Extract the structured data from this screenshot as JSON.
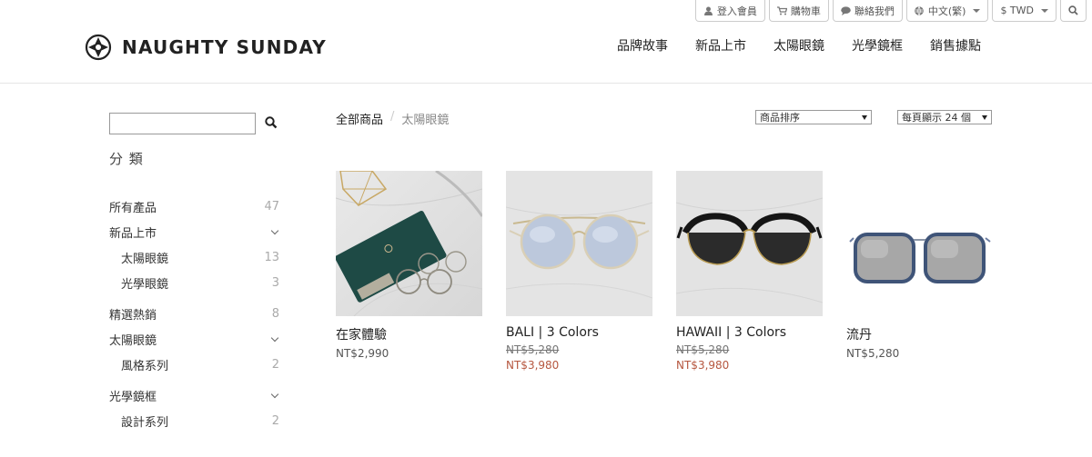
{
  "topbar": {
    "login": "登入會員",
    "cart": "購物車",
    "contact": "聯絡我們",
    "language": "中文(繁)",
    "currency": "$ TWD"
  },
  "brand": {
    "name": "NAUGHTY SUNDAY"
  },
  "nav": [
    "品牌故事",
    "新品上市",
    "太陽眼鏡",
    "光學鏡框",
    "銷售據點"
  ],
  "sidebar": {
    "search_value": "",
    "category_title": "分 類",
    "items": [
      {
        "label": "所有產品",
        "count": "47"
      },
      {
        "label": "新品上市",
        "count": ""
      },
      {
        "label": "太陽眼鏡",
        "count": "13"
      },
      {
        "label": "光學眼鏡",
        "count": "3"
      },
      {
        "label": "精選熱銷",
        "count": "8"
      },
      {
        "label": "太陽眼鏡",
        "count": ""
      },
      {
        "label": "風格系列",
        "count": "2"
      },
      {
        "label": "光學鏡框",
        "count": ""
      },
      {
        "label": "設計系列",
        "count": "2"
      }
    ]
  },
  "breadcrumb": {
    "root": "全部商品",
    "separator": "/",
    "current": "太陽眼鏡"
  },
  "controls": {
    "sort_label": "商品排序",
    "per_page_label": "每頁顯示 24 個"
  },
  "products": [
    {
      "name": "在家體驗",
      "price": "NT$2,990"
    },
    {
      "name": "BALI | 3 Colors",
      "original_price": "NT$5,280",
      "sale_price": "NT$3,980"
    },
    {
      "name": "HAWAII | 3 Colors",
      "original_price": "NT$5,280",
      "sale_price": "NT$3,980"
    },
    {
      "name": "流丹",
      "price": "NT$5,280"
    }
  ],
  "colors": {
    "sale": "#b6573f",
    "count": "#aaaaaa",
    "border": "#cccccc"
  }
}
